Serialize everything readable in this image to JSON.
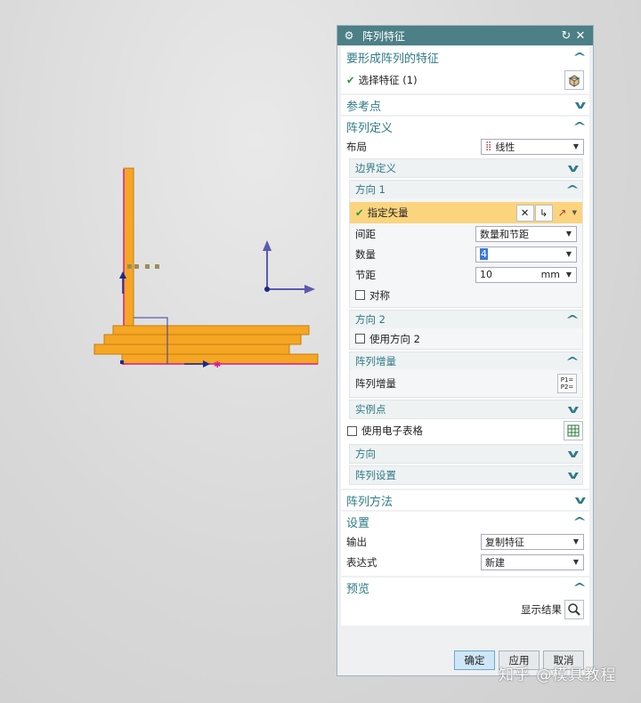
{
  "dialog": {
    "title": "阵列特征",
    "groups": {
      "features": {
        "header": "要形成阵列的特征",
        "select_label": "选择特征 (1)"
      },
      "ref_point": {
        "header": "参考点"
      },
      "array_def": {
        "header": "阵列定义",
        "layout_label": "布局",
        "layout_value": "线性",
        "boundary_header": "边界定义",
        "dir1": {
          "header": "方向 1",
          "vector_label": "指定矢量",
          "spacing_label": "间距",
          "spacing_value": "数量和节距",
          "count_label": "数量",
          "count_value": "4",
          "pitch_label": "节距",
          "pitch_value": "10",
          "pitch_unit": "mm",
          "symmetric_label": "对称"
        },
        "dir2": {
          "header": "方向 2",
          "use_label": "使用方向 2"
        },
        "increment": {
          "header": "阵列增量",
          "label": "阵列增量"
        },
        "instance_header": "实例点",
        "spreadsheet_label": "使用电子表格",
        "orientation_header": "方向",
        "settings_sub_header": "阵列设置"
      },
      "method": {
        "header": "阵列方法"
      },
      "settings": {
        "header": "设置",
        "output_label": "输出",
        "output_value": "复制特征",
        "expr_label": "表达式",
        "expr_value": "新建"
      },
      "preview": {
        "header": "预览",
        "show_result_label": "显示结果"
      }
    },
    "buttons": {
      "ok": "确定",
      "apply": "应用",
      "cancel": "取消"
    }
  },
  "watermark": "知乎 @模具教程",
  "colors": {
    "title_bar": "#4c7f86",
    "header_text": "#2f7a86",
    "highlight": "#fbd47e",
    "part_orange": "#f5a623"
  }
}
